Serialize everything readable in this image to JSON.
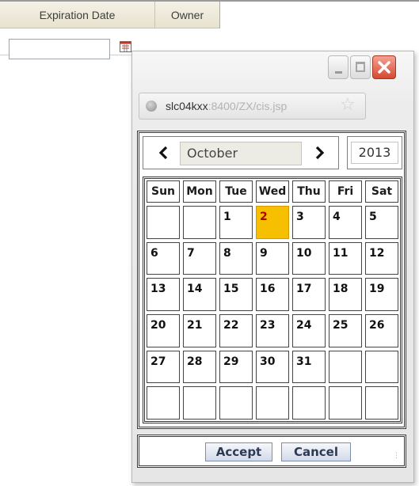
{
  "grid": {
    "columns": [
      {
        "label": "Expiration Date"
      },
      {
        "label": "Owner"
      }
    ],
    "expiration_input": {
      "value": ""
    }
  },
  "popup": {
    "address": {
      "host": "slc04kxx",
      "path": ":8400/ZX/cis.jsp"
    },
    "calendar": {
      "month": "October",
      "year": "2013",
      "weekdays": [
        "Sun",
        "Mon",
        "Tue",
        "Wed",
        "Thu",
        "Fri",
        "Sat"
      ],
      "weeks": [
        [
          "",
          "",
          "1",
          "2",
          "3",
          "4",
          "5"
        ],
        [
          "6",
          "7",
          "8",
          "9",
          "10",
          "11",
          "12"
        ],
        [
          "13",
          "14",
          "15",
          "16",
          "17",
          "18",
          "19"
        ],
        [
          "20",
          "21",
          "22",
          "23",
          "24",
          "25",
          "26"
        ],
        [
          "27",
          "28",
          "29",
          "30",
          "31",
          "",
          ""
        ],
        [
          "",
          "",
          "",
          "",
          "",
          "",
          ""
        ]
      ],
      "selected_day": "2",
      "selected_color": "#f6c000"
    },
    "buttons": {
      "accept": "Accept",
      "cancel": "Cancel"
    }
  }
}
